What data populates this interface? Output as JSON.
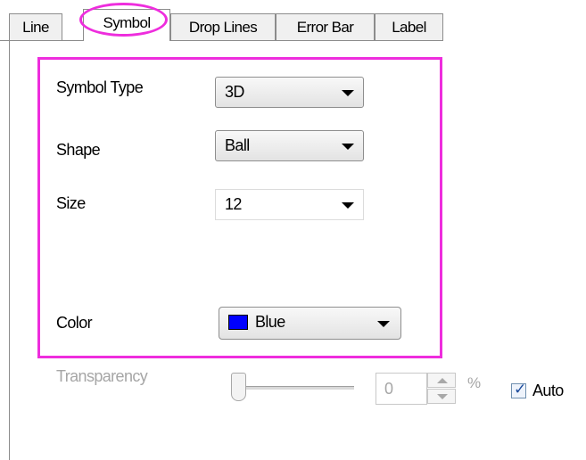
{
  "tabs": [
    {
      "label": "Line"
    },
    {
      "label": "Symbol"
    },
    {
      "label": "Drop Lines"
    },
    {
      "label": "Error Bar"
    },
    {
      "label": "Label"
    }
  ],
  "active_tab": "Symbol",
  "fields": {
    "symbol_type": {
      "label": "Symbol Type",
      "value": "3D"
    },
    "shape": {
      "label": "Shape",
      "value": "Ball"
    },
    "size": {
      "label": "Size",
      "value": "12"
    },
    "color": {
      "label": "Color",
      "value": "Blue",
      "swatch": "#0000ff"
    }
  },
  "transparency": {
    "label": "Transparency",
    "value": "0",
    "unit": "%",
    "slider_level": 0,
    "auto_label": "Auto",
    "auto_checked": true
  },
  "colors": {
    "highlight": "#ee2ddd"
  }
}
